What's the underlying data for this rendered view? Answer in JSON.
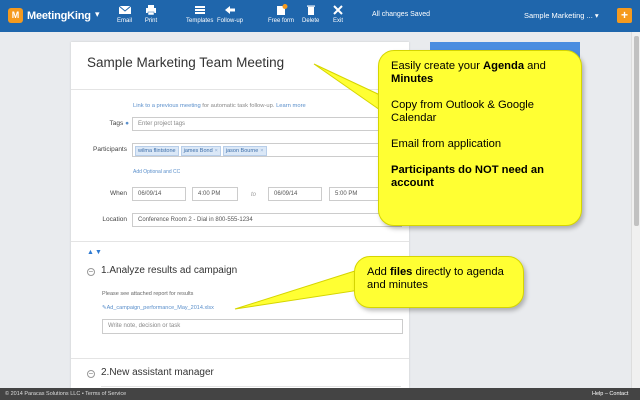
{
  "topbar": {
    "brand": "MeetingKing",
    "tools": [
      {
        "label": "Email",
        "icon": "email-icon"
      },
      {
        "label": "Print",
        "icon": "print-icon"
      },
      {
        "label": "Templates",
        "icon": "templates-icon"
      },
      {
        "label": "Follow-up",
        "icon": "follow-up-icon"
      },
      {
        "label": "Free form",
        "icon": "free-form-icon"
      },
      {
        "label": "Delete",
        "icon": "delete-icon"
      },
      {
        "label": "Exit",
        "icon": "exit-icon"
      }
    ],
    "status": "All changes Saved",
    "meeting_menu": "Sample Marketing ...",
    "add_button": "+"
  },
  "meeting": {
    "title": "Sample Marketing Team Meeting",
    "link_previous": "Link to a previous meeting",
    "link_previous_suffix": " for automatic task follow-up. ",
    "learn_more": "Learn more",
    "tags_label": "Tags",
    "tags_placeholder": "Enter project tags",
    "participants_label": "Participants",
    "participants": [
      "wilma flintstone",
      "james Bond",
      "jason Bourne"
    ],
    "add_optional": "Add Optional and CC",
    "when_label": "When",
    "start_date": "06/09/14",
    "start_time": "4:00 PM",
    "to": "to",
    "end_date": "06/09/14",
    "end_time": "5:00 PM",
    "location_label": "Location",
    "location": "Conference Room 2 - Dial in 800-555-1234"
  },
  "agenda": {
    "items": [
      {
        "title": "1.Analyze results ad campaign",
        "note": "Please see attached report for results",
        "attachment": "Ad_campaign_performance_May_2014.xlsx",
        "input_placeholder": "Write note, decision or task"
      },
      {
        "title": "2.New assistant manager"
      }
    ]
  },
  "callouts": {
    "main": {
      "line1_pre": "Easily create your ",
      "line1_bold": "Agenda",
      "line1_mid": " and ",
      "line1_bold2": "Minutes",
      "line2": "Copy from Outlook & Google Calendar",
      "line3": "Email from application",
      "line4": "Participants do NOT need an account"
    },
    "files": {
      "pre": "Add ",
      "bold": "files",
      "post": " directly to agenda and minutes"
    },
    "color": "#ffff33"
  },
  "footer": {
    "copyright": "© 2014 Paracas Solutions LLC • Terms of Service",
    "help": "Help – Contact"
  },
  "colors": {
    "topbar": "#1f66ac",
    "accent": "#f59a1e",
    "link": "#5a8fcb"
  }
}
